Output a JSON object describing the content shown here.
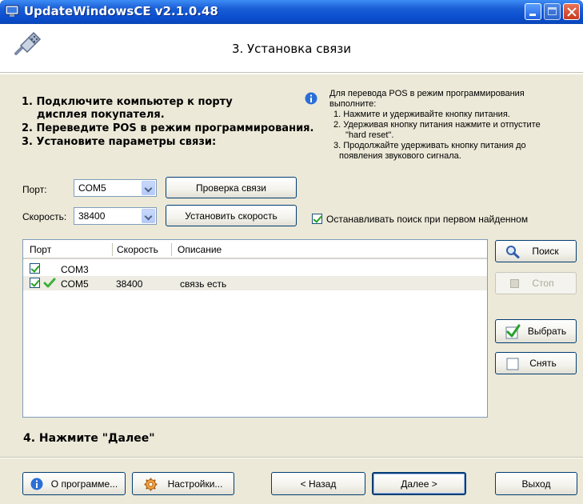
{
  "window": {
    "title": "UpdateWindowsCE v2.1.0.48"
  },
  "header": {
    "step_title": "3. Установка связи"
  },
  "instructions": {
    "line1": "1. Подключите компьютер к порту",
    "line1b": "дисплея покупателя.",
    "line2": "2. Переведите POS в режим программирования.",
    "line3": "3. Установите параметры связи:",
    "line4": "4. Нажмите \"Далее\""
  },
  "note": {
    "intro1": "Для перевода POS в режим программирования",
    "intro2": "выполните:",
    "step1": "1. Нажмите и удерживайте кнопку питания.",
    "step2a": "2. Удерживая кнопку питания нажмите и отпустите",
    "step2b": "\"hard reset\".",
    "step3a": "3. Продолжайте удерживать кнопку питания до",
    "step3b": "появления  звукового сигнала."
  },
  "form": {
    "port_label": "Порт:",
    "port_value": "COM5",
    "speed_label": "Скорость:",
    "speed_value": "38400",
    "check_button": "Проверка связи",
    "set_speed_button": "Установить скорость",
    "stop_on_first_label": "Останавливать поиск при первом найденном",
    "stop_on_first_checked": true
  },
  "list": {
    "columns": [
      "Порт",
      "Скорость",
      "Описание"
    ],
    "rows": [
      {
        "checked": true,
        "ok": false,
        "port": "COM3",
        "speed": "",
        "description": ""
      },
      {
        "checked": true,
        "ok": true,
        "port": "COM5",
        "speed": "38400",
        "description": "связь есть"
      }
    ]
  },
  "side_buttons": {
    "search": "Поиск",
    "stop": "Стоп",
    "select": "Выбрать",
    "deselect": "Снять"
  },
  "footer": {
    "about": "О программе...",
    "settings": "Настройки...",
    "back": "< Назад",
    "next": "Далее >",
    "exit": "Выход"
  },
  "colors": {
    "titlebar": "#0b4fd0",
    "panel": "#ece9d8",
    "button_border": "#003c74",
    "check_green": "#21a121"
  }
}
